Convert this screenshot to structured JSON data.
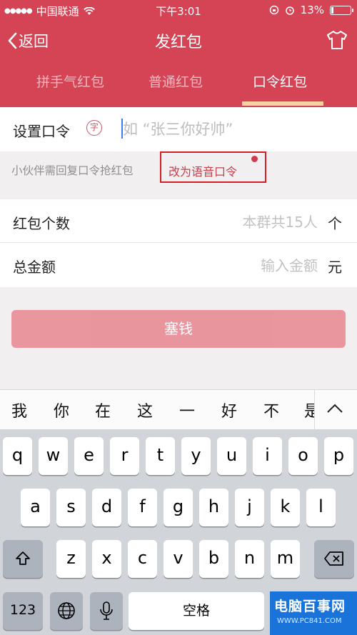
{
  "status_bar": {
    "carrier": "中国联通",
    "time": "下午3:01",
    "battery": "13%",
    "battery_level": 0.13
  },
  "nav": {
    "back_label": "返回",
    "title": "发红包"
  },
  "tabs": [
    {
      "label": "拼手气红包",
      "active": false
    },
    {
      "label": "普通红包",
      "active": false
    },
    {
      "label": "口令红包",
      "active": true
    }
  ],
  "password": {
    "label": "设置口令",
    "char_badge": "字",
    "placeholder": "如 “张三你好帅”"
  },
  "hint": {
    "text": "小伙伴需回复口令抢红包",
    "voice_link": "改为语音口令"
  },
  "count_row": {
    "label": "红包个数",
    "placeholder": "本群共15人",
    "unit": "个"
  },
  "amount_row": {
    "label": "总金额",
    "placeholder": "输入金额",
    "unit": "元"
  },
  "send_button": "塞钱",
  "candidates": [
    "我",
    "你",
    "在",
    "这",
    "一",
    "好",
    "不",
    "是"
  ],
  "keyboard": {
    "row1": [
      "q",
      "w",
      "e",
      "r",
      "t",
      "y",
      "u",
      "i",
      "o",
      "p"
    ],
    "row2": [
      "a",
      "s",
      "d",
      "f",
      "g",
      "h",
      "j",
      "k",
      "l"
    ],
    "row3": [
      "z",
      "x",
      "c",
      "v",
      "b",
      "n",
      "m"
    ],
    "numbers_key": "123",
    "space_label": "空格"
  },
  "watermark": {
    "title": "电脑百事网",
    "url": "WWW.PC841.COM"
  },
  "colors": {
    "brand_red": "#d54455",
    "tab_indicator": "#f6d2a1",
    "send_button": "#e88c96",
    "link_red": "#c2414d"
  }
}
